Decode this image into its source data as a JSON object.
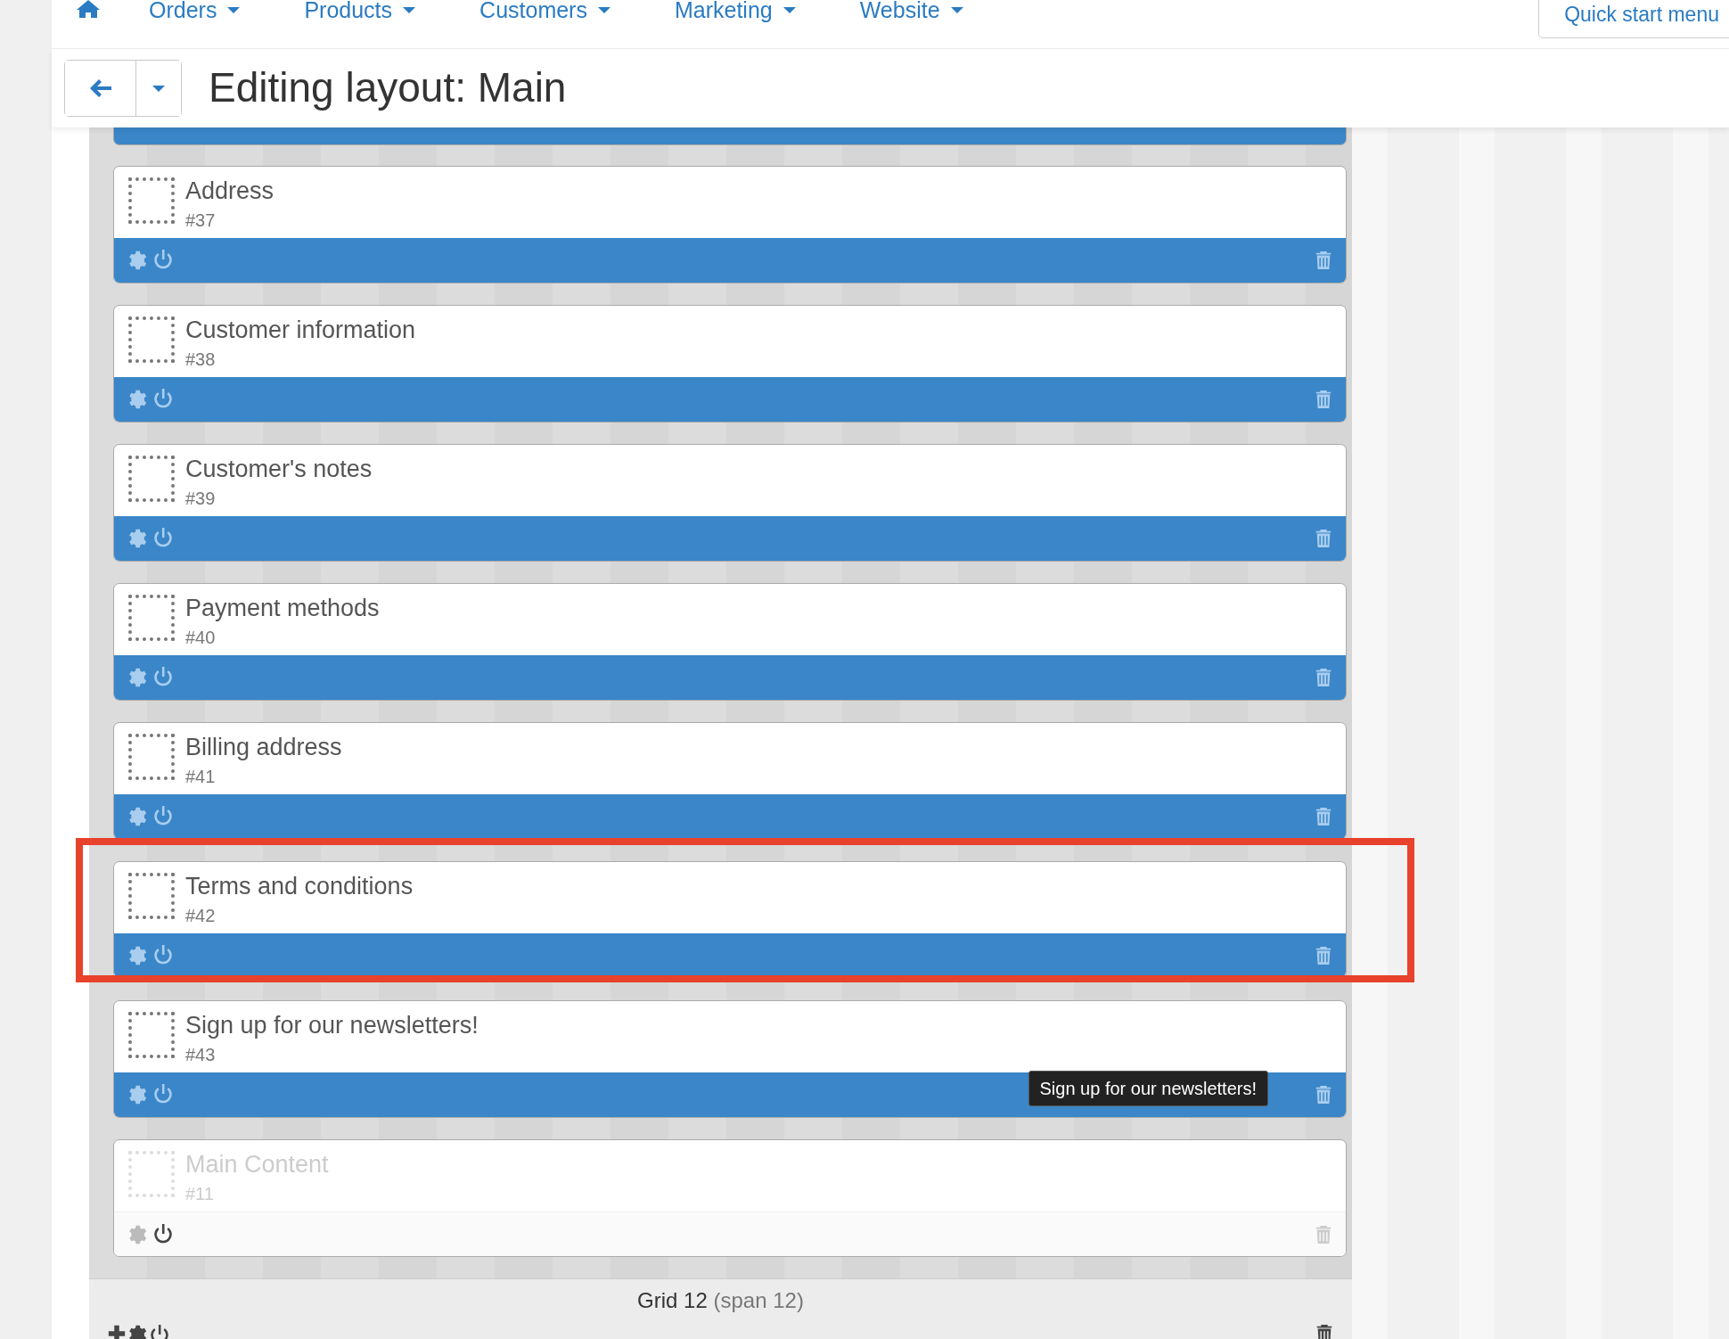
{
  "nav": {
    "items": [
      {
        "label": "Orders"
      },
      {
        "label": "Products"
      },
      {
        "label": "Customers"
      },
      {
        "label": "Marketing"
      },
      {
        "label": "Website"
      }
    ],
    "quick_start": "Quick start menu"
  },
  "header": {
    "title": "Editing layout: Main"
  },
  "blocks": [
    {
      "name": "Address",
      "id": "#37",
      "disabled": false,
      "highlighted": false
    },
    {
      "name": "Customer information",
      "id": "#38",
      "disabled": false,
      "highlighted": false
    },
    {
      "name": "Customer's notes",
      "id": "#39",
      "disabled": false,
      "highlighted": false
    },
    {
      "name": "Payment methods",
      "id": "#40",
      "disabled": false,
      "highlighted": false
    },
    {
      "name": "Billing address",
      "id": "#41",
      "disabled": false,
      "highlighted": false
    },
    {
      "name": "Terms and conditions",
      "id": "#42",
      "disabled": false,
      "highlighted": true
    },
    {
      "name": "Sign up for our newsletters!",
      "id": "#43",
      "disabled": false,
      "highlighted": false,
      "tooltip": "Sign up for our newsletters!"
    },
    {
      "name": "Main Content",
      "id": "#11",
      "disabled": true,
      "highlighted": false
    }
  ],
  "grid": {
    "label": "Grid 12",
    "span": "(span 12)"
  }
}
